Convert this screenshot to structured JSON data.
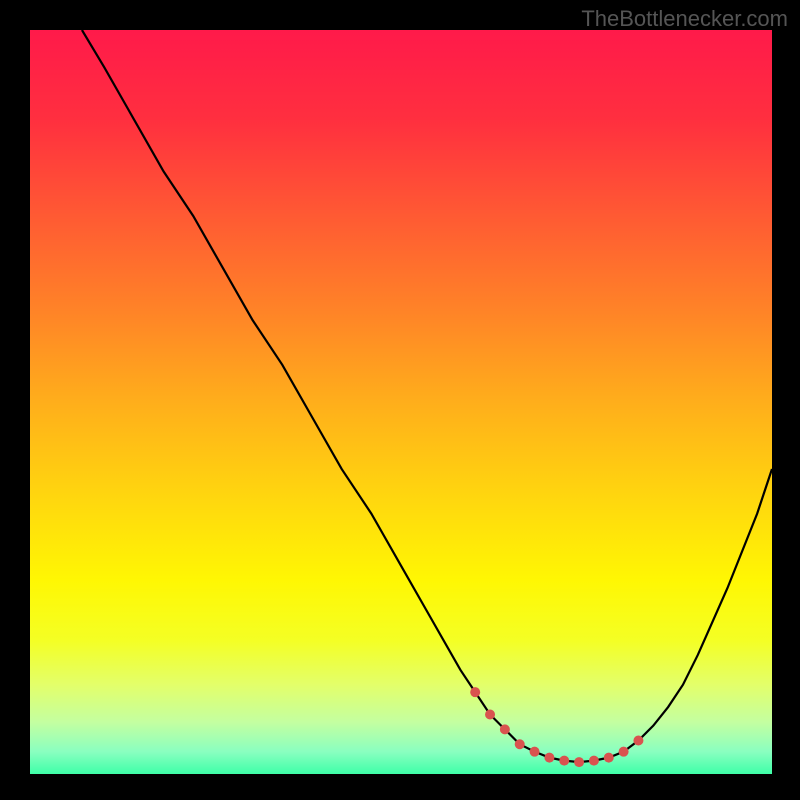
{
  "attribution": "TheBottlenecker.com",
  "chart_data": {
    "type": "line",
    "title": "",
    "xlabel": "",
    "ylabel": "",
    "xlim": [
      0,
      100
    ],
    "ylim": [
      0,
      100
    ],
    "grid": false,
    "background_gradient": {
      "stops": [
        {
          "pos": 0.0,
          "color": "#ff1a4a"
        },
        {
          "pos": 0.12,
          "color": "#ff2f3f"
        },
        {
          "pos": 0.25,
          "color": "#ff5a33"
        },
        {
          "pos": 0.38,
          "color": "#ff8427"
        },
        {
          "pos": 0.5,
          "color": "#ffae1b"
        },
        {
          "pos": 0.62,
          "color": "#ffd40f"
        },
        {
          "pos": 0.74,
          "color": "#fff703"
        },
        {
          "pos": 0.82,
          "color": "#f4ff24"
        },
        {
          "pos": 0.88,
          "color": "#e3ff6a"
        },
        {
          "pos": 0.93,
          "color": "#c4ffa0"
        },
        {
          "pos": 0.97,
          "color": "#8affc0"
        },
        {
          "pos": 1.0,
          "color": "#3effa8"
        }
      ]
    },
    "series": [
      {
        "name": "bottleneck-curve",
        "color": "#000000",
        "x": [
          7,
          10,
          14,
          18,
          22,
          26,
          30,
          34,
          38,
          42,
          46,
          50,
          54,
          58,
          60,
          62,
          64,
          66,
          68,
          70,
          72,
          74,
          76,
          78,
          80,
          82,
          84,
          86,
          88,
          90,
          94,
          98,
          100
        ],
        "y": [
          100,
          95,
          88,
          81,
          75,
          68,
          61,
          55,
          48,
          41,
          35,
          28,
          21,
          14,
          11,
          8,
          6,
          4,
          3,
          2.2,
          1.8,
          1.6,
          1.8,
          2.2,
          3,
          4.5,
          6.5,
          9,
          12,
          16,
          25,
          35,
          41
        ]
      }
    ],
    "markers": {
      "name": "highlight-dots",
      "color": "#d9534f",
      "points": [
        {
          "x": 60,
          "y": 11
        },
        {
          "x": 62,
          "y": 8
        },
        {
          "x": 64,
          "y": 6
        },
        {
          "x": 66,
          "y": 4
        },
        {
          "x": 68,
          "y": 3
        },
        {
          "x": 70,
          "y": 2.2
        },
        {
          "x": 72,
          "y": 1.8
        },
        {
          "x": 74,
          "y": 1.6
        },
        {
          "x": 76,
          "y": 1.8
        },
        {
          "x": 78,
          "y": 2.2
        },
        {
          "x": 80,
          "y": 3
        },
        {
          "x": 82,
          "y": 4.5
        }
      ]
    }
  }
}
